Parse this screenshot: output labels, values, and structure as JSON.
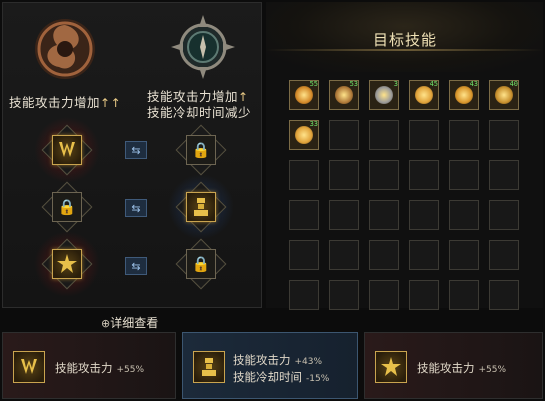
{
  "left": {
    "label_left": "技能攻击力增加",
    "label_right_1": "技能攻击力增加",
    "label_right_2": "技能冷却时间减少",
    "arrow": "↑",
    "swap_symbol": "⇆",
    "lock_symbol": "🔒",
    "detail_icon": "⊕",
    "detail_label": "详细查看"
  },
  "right": {
    "title": "目标技能",
    "row1_levels": [
      "55",
      "53",
      "3",
      "45",
      "43",
      "40"
    ],
    "row2_levels": [
      "33"
    ]
  },
  "bottom": {
    "card1_label": "技能攻击力",
    "card1_value": "+55%",
    "card2_label1": "技能攻击力",
    "card2_value1": "+43%",
    "card2_label2": "技能冷却时间",
    "card2_value2": "-15%",
    "card3_label": "技能攻击力",
    "card3_value": "+55%"
  },
  "colors": {
    "gold": "#c9a44f",
    "level_green": "#6fe06a",
    "blue_card": "#1c2a3a",
    "red_card": "#2a1a1a"
  }
}
